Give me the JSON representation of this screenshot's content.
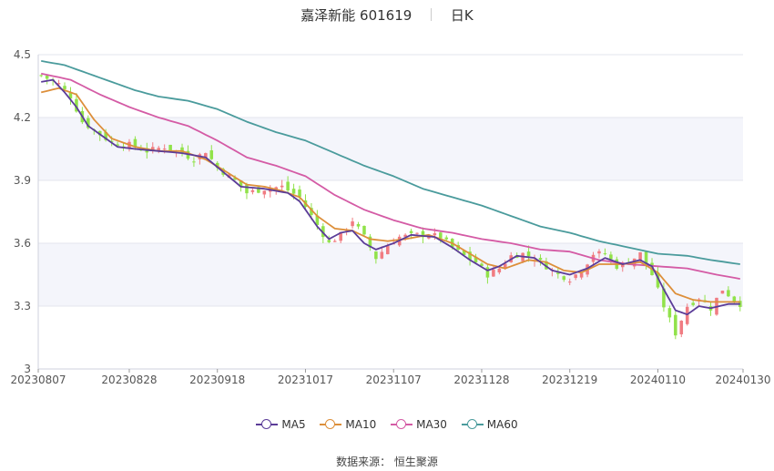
{
  "header": {
    "stock": "嘉泽新能 601619",
    "period": "日K"
  },
  "legend": {
    "ma5": "MA5",
    "ma10": "MA10",
    "ma30": "MA30",
    "ma60": "MA60"
  },
  "source": {
    "label": "数据来源：",
    "name": "恒生聚源"
  },
  "colors": {
    "up": "#f07c82",
    "down": "#91e24a",
    "ma5": "#5b3c98",
    "ma10": "#dd8f3a",
    "ma30": "#d45ba5",
    "ma60": "#4a9b9c",
    "band": "#f4f5fb",
    "grid": "#e3e5ee"
  },
  "chart_data": {
    "type": "candlestick",
    "ylim": [
      3,
      4.5
    ],
    "yticks": [
      "4.5",
      "4.2",
      "3.9",
      "3.6",
      "3.3",
      "3"
    ],
    "ytick_values": [
      4.5,
      4.2,
      3.9,
      3.6,
      3.3,
      3.0
    ],
    "xticks": [
      "20230807",
      "20230828",
      "20230918",
      "20231017",
      "20231107",
      "20231128",
      "20231219",
      "20240110",
      "20240130"
    ],
    "xtick_index": [
      0,
      15,
      30,
      45,
      60,
      75,
      90,
      105,
      119
    ],
    "n": 120,
    "close_keys": [
      [
        0,
        4.4
      ],
      [
        3,
        4.36
      ],
      [
        5,
        4.3
      ],
      [
        7,
        4.18
      ],
      [
        9,
        4.14
      ],
      [
        12,
        4.08
      ],
      [
        15,
        4.07
      ],
      [
        18,
        4.04
      ],
      [
        21,
        4.06
      ],
      [
        24,
        4.03
      ],
      [
        26,
        4.0
      ],
      [
        28,
        4.04
      ],
      [
        30,
        3.96
      ],
      [
        33,
        3.9
      ],
      [
        35,
        3.84
      ],
      [
        38,
        3.86
      ],
      [
        41,
        3.87
      ],
      [
        44,
        3.82
      ],
      [
        46,
        3.73
      ],
      [
        49,
        3.6
      ],
      [
        51,
        3.64
      ],
      [
        53,
        3.71
      ],
      [
        55,
        3.63
      ],
      [
        57,
        3.53
      ],
      [
        59,
        3.59
      ],
      [
        61,
        3.63
      ],
      [
        64,
        3.64
      ],
      [
        66,
        3.64
      ],
      [
        68,
        3.63
      ],
      [
        70,
        3.58
      ],
      [
        72,
        3.54
      ],
      [
        74,
        3.51
      ],
      [
        76,
        3.45
      ],
      [
        78,
        3.48
      ],
      [
        80,
        3.54
      ],
      [
        82,
        3.55
      ],
      [
        84,
        3.53
      ],
      [
        86,
        3.49
      ],
      [
        88,
        3.45
      ],
      [
        90,
        3.43
      ],
      [
        92,
        3.47
      ],
      [
        94,
        3.55
      ],
      [
        96,
        3.55
      ],
      [
        98,
        3.49
      ],
      [
        100,
        3.51
      ],
      [
        102,
        3.55
      ],
      [
        104,
        3.45
      ],
      [
        106,
        3.3
      ],
      [
        108,
        3.17
      ],
      [
        110,
        3.3
      ],
      [
        112,
        3.34
      ],
      [
        114,
        3.29
      ],
      [
        116,
        3.38
      ],
      [
        118,
        3.33
      ],
      [
        119,
        3.31
      ]
    ],
    "ma_keys": {
      "MA5": [
        [
          0,
          4.37
        ],
        [
          2,
          4.38
        ],
        [
          4,
          4.32
        ],
        [
          6,
          4.25
        ],
        [
          8,
          4.16
        ],
        [
          10,
          4.12
        ],
        [
          13,
          4.06
        ],
        [
          16,
          4.05
        ],
        [
          20,
          4.04
        ],
        [
          24,
          4.03
        ],
        [
          28,
          4.01
        ],
        [
          31,
          3.94
        ],
        [
          34,
          3.87
        ],
        [
          38,
          3.86
        ],
        [
          42,
          3.84
        ],
        [
          44,
          3.8
        ],
        [
          47,
          3.68
        ],
        [
          49,
          3.62
        ],
        [
          51,
          3.65
        ],
        [
          53,
          3.66
        ],
        [
          55,
          3.6
        ],
        [
          57,
          3.57
        ],
        [
          60,
          3.6
        ],
        [
          63,
          3.64
        ],
        [
          67,
          3.63
        ],
        [
          70,
          3.58
        ],
        [
          73,
          3.52
        ],
        [
          76,
          3.47
        ],
        [
          78,
          3.49
        ],
        [
          81,
          3.54
        ],
        [
          84,
          3.53
        ],
        [
          87,
          3.47
        ],
        [
          90,
          3.45
        ],
        [
          93,
          3.48
        ],
        [
          96,
          3.53
        ],
        [
          99,
          3.5
        ],
        [
          102,
          3.52
        ],
        [
          104,
          3.49
        ],
        [
          106,
          3.38
        ],
        [
          108,
          3.28
        ],
        [
          110,
          3.26
        ],
        [
          112,
          3.3
        ],
        [
          114,
          3.29
        ],
        [
          117,
          3.31
        ],
        [
          119,
          3.31
        ]
      ],
      "MA10": [
        [
          0,
          4.32
        ],
        [
          3,
          4.34
        ],
        [
          6,
          4.31
        ],
        [
          9,
          4.19
        ],
        [
          12,
          4.1
        ],
        [
          16,
          4.06
        ],
        [
          20,
          4.04
        ],
        [
          24,
          4.04
        ],
        [
          28,
          4.0
        ],
        [
          31,
          3.95
        ],
        [
          35,
          3.88
        ],
        [
          38,
          3.87
        ],
        [
          41,
          3.85
        ],
        [
          44,
          3.82
        ],
        [
          47,
          3.73
        ],
        [
          50,
          3.67
        ],
        [
          53,
          3.66
        ],
        [
          56,
          3.62
        ],
        [
          59,
          3.61
        ],
        [
          62,
          3.62
        ],
        [
          66,
          3.64
        ],
        [
          70,
          3.6
        ],
        [
          73,
          3.55
        ],
        [
          76,
          3.5
        ],
        [
          79,
          3.48
        ],
        [
          83,
          3.52
        ],
        [
          86,
          3.51
        ],
        [
          89,
          3.47
        ],
        [
          92,
          3.46
        ],
        [
          95,
          3.5
        ],
        [
          99,
          3.5
        ],
        [
          102,
          3.51
        ],
        [
          105,
          3.46
        ],
        [
          108,
          3.36
        ],
        [
          111,
          3.33
        ],
        [
          114,
          3.32
        ],
        [
          117,
          3.32
        ],
        [
          119,
          3.32
        ]
      ],
      "MA30": [
        [
          0,
          4.41
        ],
        [
          5,
          4.38
        ],
        [
          10,
          4.31
        ],
        [
          15,
          4.25
        ],
        [
          20,
          4.2
        ],
        [
          25,
          4.16
        ],
        [
          30,
          4.09
        ],
        [
          35,
          4.01
        ],
        [
          40,
          3.97
        ],
        [
          45,
          3.92
        ],
        [
          50,
          3.83
        ],
        [
          55,
          3.76
        ],
        [
          60,
          3.71
        ],
        [
          65,
          3.67
        ],
        [
          70,
          3.65
        ],
        [
          75,
          3.62
        ],
        [
          80,
          3.6
        ],
        [
          85,
          3.57
        ],
        [
          90,
          3.56
        ],
        [
          95,
          3.52
        ],
        [
          100,
          3.5
        ],
        [
          105,
          3.49
        ],
        [
          110,
          3.48
        ],
        [
          115,
          3.45
        ],
        [
          119,
          3.43
        ]
      ],
      "MA60": [
        [
          0,
          4.47
        ],
        [
          4,
          4.45
        ],
        [
          8,
          4.41
        ],
        [
          12,
          4.37
        ],
        [
          16,
          4.33
        ],
        [
          20,
          4.3
        ],
        [
          25,
          4.28
        ],
        [
          30,
          4.24
        ],
        [
          35,
          4.18
        ],
        [
          40,
          4.13
        ],
        [
          45,
          4.09
        ],
        [
          50,
          4.03
        ],
        [
          55,
          3.97
        ],
        [
          60,
          3.92
        ],
        [
          65,
          3.86
        ],
        [
          70,
          3.82
        ],
        [
          75,
          3.78
        ],
        [
          80,
          3.73
        ],
        [
          85,
          3.68
        ],
        [
          90,
          3.65
        ],
        [
          95,
          3.61
        ],
        [
          100,
          3.58
        ],
        [
          105,
          3.55
        ],
        [
          110,
          3.54
        ],
        [
          114,
          3.52
        ],
        [
          119,
          3.5
        ]
      ]
    },
    "grid": true,
    "legend_position": "bottom"
  }
}
